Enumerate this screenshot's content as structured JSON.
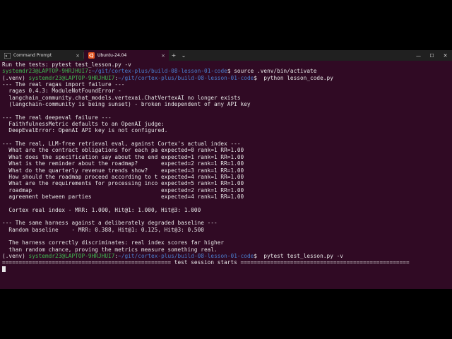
{
  "window": {
    "tabs": [
      {
        "label": "Command Prompt",
        "icon": "cmd-icon",
        "close": "×"
      },
      {
        "label": "Ubuntu-24.04",
        "icon": "ubuntu-icon",
        "close": "×"
      }
    ],
    "new_tab": "+",
    "dropdown": "⌄",
    "minimize": "—",
    "maximize": "☐",
    "close": "✕"
  },
  "colors": {
    "background": "#300a24",
    "titlebar": "#202020",
    "prompt_user": "#3fb950",
    "prompt_path": "#4a7fd0",
    "text": "#d8d8d8"
  },
  "terminal": {
    "lines": [
      {
        "segs": [
          {
            "t": "Run the tests: pytest test_lesson.py -v",
            "c": "w"
          }
        ]
      },
      {
        "segs": [
          {
            "t": "systemdr23@LAPTOP-9HRJHUI7",
            "c": "g"
          },
          {
            "t": ":",
            "c": "w"
          },
          {
            "t": "~/git/cortex-plus/build-08-lesson-01-code",
            "c": "b"
          },
          {
            "t": "$ source .venv/bin/activate",
            "c": "w"
          }
        ]
      },
      {
        "segs": [
          {
            "t": "(.venv) ",
            "c": "w"
          },
          {
            "t": "systemdr23@LAPTOP-9HRJHUI7",
            "c": "g"
          },
          {
            "t": ":",
            "c": "w"
          },
          {
            "t": "~/git/cortex-plus/build-08-lesson-01-code",
            "c": "b"
          },
          {
            "t": "$  python lesson_code.py",
            "c": "w"
          }
        ]
      },
      {
        "segs": [
          {
            "t": "--- The real ragas import failure ---",
            "c": "w"
          }
        ]
      },
      {
        "segs": [
          {
            "t": "  ragas 0.4.3: ModuleNotFoundError -",
            "c": "w"
          }
        ]
      },
      {
        "segs": [
          {
            "t": "  langchain_community.chat_models.vertexai.ChatVertexAI no longer exists",
            "c": "w"
          }
        ]
      },
      {
        "segs": [
          {
            "t": "  (langchain-community is being sunset) - broken independent of any API key",
            "c": "w"
          }
        ]
      },
      {
        "segs": [
          {
            "t": "",
            "c": "w"
          }
        ]
      },
      {
        "segs": [
          {
            "t": "--- The real deepeval failure ---",
            "c": "w"
          }
        ]
      },
      {
        "segs": [
          {
            "t": "  FaithfulnessMetric defaults to an OpenAI judge:",
            "c": "w"
          }
        ]
      },
      {
        "segs": [
          {
            "t": "  DeepEvalError: OpenAI API key is not configured.",
            "c": "w"
          }
        ]
      },
      {
        "segs": [
          {
            "t": "",
            "c": "w"
          }
        ]
      },
      {
        "segs": [
          {
            "t": "--- The real, LLM-free retrieval eval, against Cortex's actual index ---",
            "c": "w"
          }
        ]
      },
      {
        "segs": [
          {
            "t": "  What are the contract obligations for each pa expected=0 rank=1 RR=1.00",
            "c": "w"
          }
        ]
      },
      {
        "segs": [
          {
            "t": "  What does the specification say about the end expected=1 rank=1 RR=1.00",
            "c": "w"
          }
        ]
      },
      {
        "segs": [
          {
            "t": "  What is the reminder about the roadmap?       expected=2 rank=1 RR=1.00",
            "c": "w"
          }
        ]
      },
      {
        "segs": [
          {
            "t": "  What do the quarterly revenue trends show?    expected=3 rank=1 RR=1.00",
            "c": "w"
          }
        ]
      },
      {
        "segs": [
          {
            "t": "  How should the roadmap proceed according to t expected=4 rank=1 RR=1.00",
            "c": "w"
          }
        ]
      },
      {
        "segs": [
          {
            "t": "  What are the requirements for processing inco expected=5 rank=1 RR=1.00",
            "c": "w"
          }
        ]
      },
      {
        "segs": [
          {
            "t": "  roadmap                                       expected=2 rank=1 RR=1.00",
            "c": "w"
          }
        ]
      },
      {
        "segs": [
          {
            "t": "  agreement between parties                     expected=4 rank=1 RR=1.00",
            "c": "w"
          }
        ]
      },
      {
        "segs": [
          {
            "t": "",
            "c": "w"
          }
        ]
      },
      {
        "segs": [
          {
            "t": "  Cortex real index - MRR: 1.000, Hit@1: 1.000, Hit@3: 1.000",
            "c": "w"
          }
        ]
      },
      {
        "segs": [
          {
            "t": "",
            "c": "w"
          }
        ]
      },
      {
        "segs": [
          {
            "t": "--- The same harness against a deliberately degraded baseline ---",
            "c": "w"
          }
        ]
      },
      {
        "segs": [
          {
            "t": "  Random baseline    - MRR: 0.388, Hit@1: 0.125, Hit@3: 0.500",
            "c": "w"
          }
        ]
      },
      {
        "segs": [
          {
            "t": "",
            "c": "w"
          }
        ]
      },
      {
        "segs": [
          {
            "t": "  The harness correctly discriminates: real index scores far higher",
            "c": "w"
          }
        ]
      },
      {
        "segs": [
          {
            "t": "  than random chance, proving the metrics measure something real.",
            "c": "w"
          }
        ]
      },
      {
        "segs": [
          {
            "t": "(.venv) ",
            "c": "w"
          },
          {
            "t": "systemdr23@LAPTOP-9HRJHUI7",
            "c": "g"
          },
          {
            "t": ":",
            "c": "w"
          },
          {
            "t": "~/git/cortex-plus/build-08-lesson-01-code",
            "c": "b"
          },
          {
            "t": "$  pytest test_lesson.py -v",
            "c": "w"
          }
        ]
      },
      {
        "segs": [
          {
            "t": "=================================================== test session starts ===================================================",
            "c": "w"
          }
        ]
      }
    ]
  }
}
